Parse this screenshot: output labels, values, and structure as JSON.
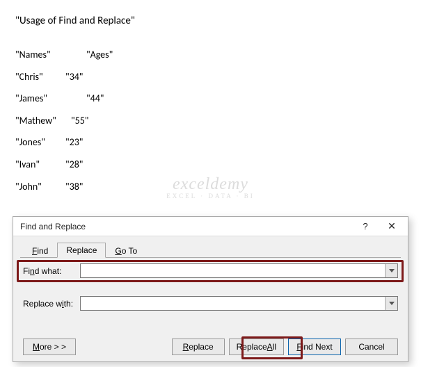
{
  "document": {
    "title": "\"Usage of Find and Replace\"",
    "headers": {
      "col1": "\"Names\"",
      "col2": "\"Ages\""
    },
    "rows": [
      {
        "name": "\"Chris\"",
        "age": "\"34\""
      },
      {
        "name": "\"James\"",
        "age": "\"44\""
      },
      {
        "name": "\"Mathew\"",
        "age": "\"55\""
      },
      {
        "name": "\"Jones\"",
        "age": "\"23\""
      },
      {
        "name": "\"Ivan\"",
        "age": "\"28\""
      },
      {
        "name": "\"John\"",
        "age": "\"38\""
      }
    ]
  },
  "dialog": {
    "title": "Find and Replace",
    "help": "?",
    "close": "✕",
    "tabs": {
      "find": "Find",
      "replace": "Replace",
      "goto": "Go To",
      "active": "replace"
    },
    "fields": {
      "find_label_pre": "Fi",
      "find_label_ul": "n",
      "find_label_post": "d what:",
      "find_value": "",
      "replace_label_pre": "Replace w",
      "replace_label_ul": "i",
      "replace_label_post": "th:",
      "replace_value": ""
    },
    "buttons": {
      "more_ul": "M",
      "more_post": "ore > >",
      "replace_ul": "R",
      "replace_post": "eplace",
      "replaceall_pre": "Replace ",
      "replaceall_ul": "A",
      "replaceall_post": "ll",
      "findnext_ul": "F",
      "findnext_post": "ind Next",
      "cancel": "Cancel"
    }
  },
  "watermark": {
    "line1": "exceldemy",
    "line2": "EXCEL · DATA · BI"
  }
}
